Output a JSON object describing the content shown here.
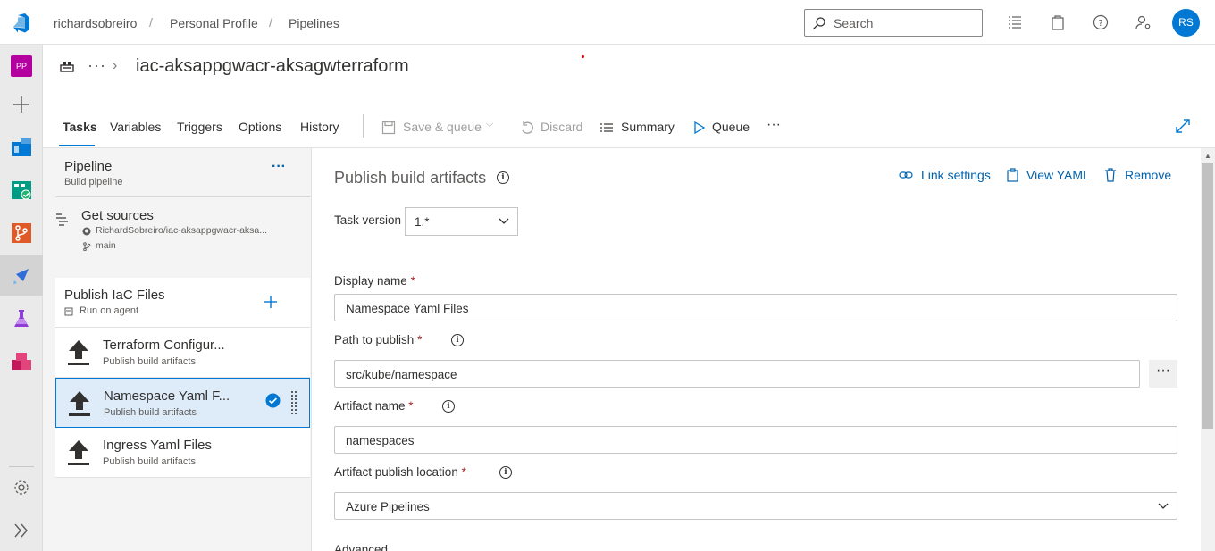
{
  "breadcrumb": {
    "org": "richardsobreiro",
    "project": "Personal Profile",
    "section": "Pipelines"
  },
  "search": {
    "placeholder": "Search"
  },
  "user": {
    "initials": "RS"
  },
  "project_badge": "PP",
  "pipeline": {
    "name": "iac-aksappgwacr-aksagwterraform",
    "more": "···"
  },
  "tabs": [
    "Tasks",
    "Variables",
    "Triggers",
    "Options",
    "History"
  ],
  "toolbar": {
    "save_queue": "Save & queue",
    "discard": "Discard",
    "summary": "Summary",
    "queue": "Queue",
    "more": "···"
  },
  "tasklist": {
    "pipeline_title": "Pipeline",
    "pipeline_sub": "Build pipeline",
    "get_sources_title": "Get sources",
    "get_sources_repo": "RichardSobreiro/iac-aksappgwacr-aksa...",
    "get_sources_branch": "main",
    "phase_title": "Publish IaC Files",
    "phase_sub": "Run on agent",
    "tasks": [
      {
        "title": "Terraform Configur...",
        "sub": "Publish build artifacts"
      },
      {
        "title": "Namespace Yaml F...",
        "sub": "Publish build artifacts"
      },
      {
        "title": "Ingress Yaml Files",
        "sub": "Publish build artifacts"
      }
    ]
  },
  "detail": {
    "heading": "Publish build artifacts",
    "link_settings": "Link settings",
    "view_yaml": "View YAML",
    "remove": "Remove",
    "task_version_label": "Task version",
    "task_version": "1.*",
    "display_name_label": "Display name",
    "display_name": "Namespace Yaml Files",
    "path_label": "Path to publish",
    "path": "src/kube/namespace",
    "path_more": "···",
    "artifact_name_label": "Artifact name",
    "artifact_name": "namespaces",
    "publish_location_label": "Artifact publish location",
    "publish_location": "Azure Pipelines",
    "advanced": "Advanced"
  },
  "colors": {
    "accent": "#0078d4",
    "project_badge": "#b4009e",
    "required": "#a4262c"
  }
}
